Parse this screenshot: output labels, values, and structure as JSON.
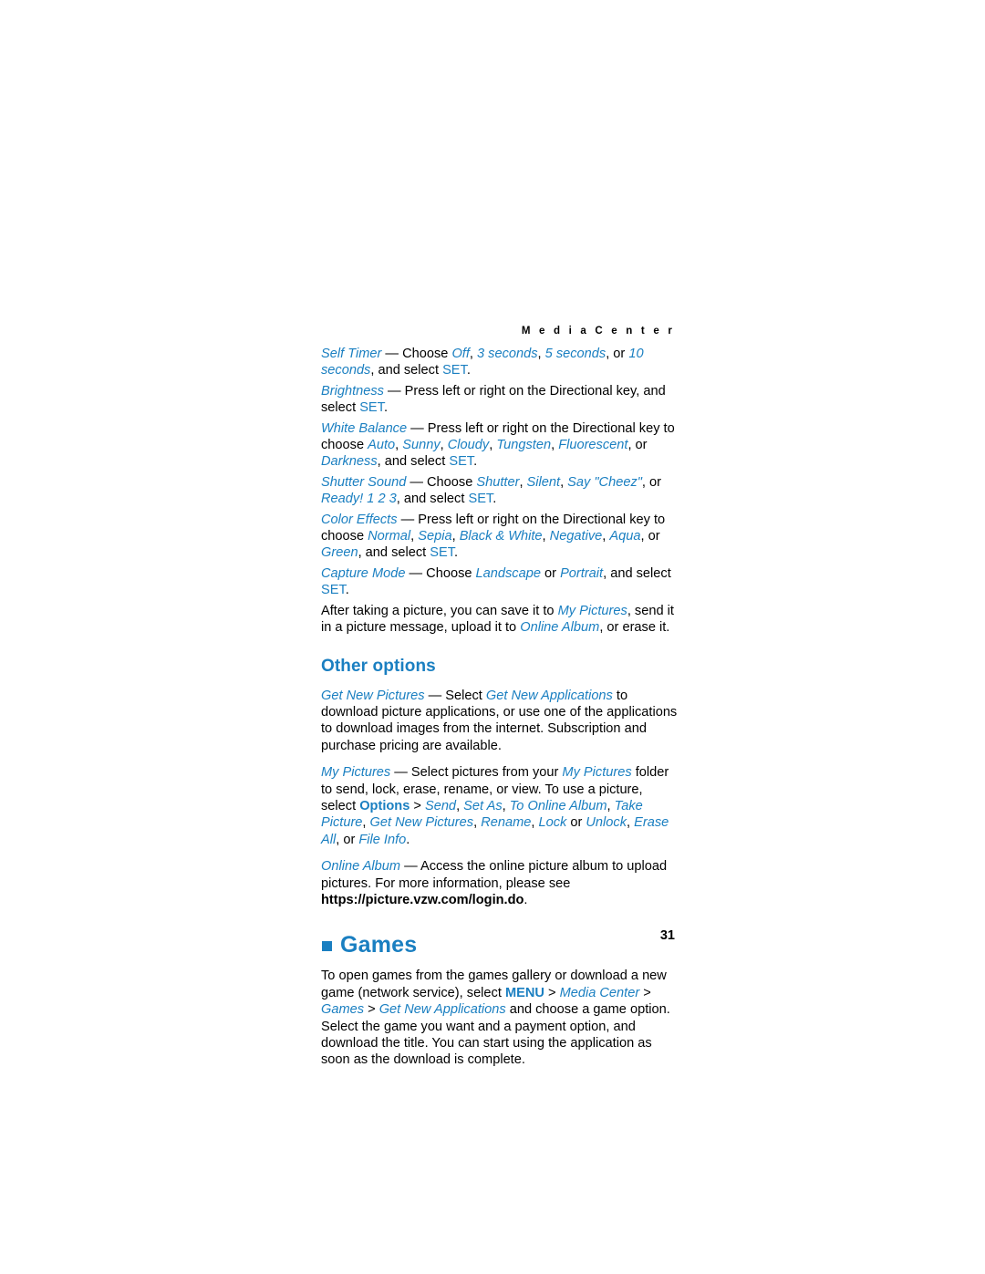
{
  "header": {
    "running_head": "M e d i a   C e n t e r"
  },
  "page_number": "31",
  "colors": {
    "accent": "#1a7fc1",
    "text": "#000000",
    "background": "#ffffff"
  },
  "paragraphs": {
    "self_timer": {
      "term": "Self Timer",
      "dash": " — Choose ",
      "opt1": "Off",
      "sep1": ", ",
      "opt2": "3 seconds",
      "sep2": ", ",
      "opt3": "5 seconds",
      "sep3": ", or ",
      "opt4": "10 seconds",
      "sep4": ", and select ",
      "set": "SET",
      "end": "."
    },
    "brightness": {
      "term": "Brightness",
      "body": " — Press left or right on the Directional key, and select ",
      "set": "SET",
      "end": "."
    },
    "white_balance": {
      "term": "White Balance",
      "body": " — Press left or right on the Directional key to choose ",
      "opt1": "Auto",
      "sep1": ", ",
      "opt2": "Sunny",
      "sep2": ", ",
      "opt3": "Cloudy",
      "sep3": ", ",
      "opt4": "Tungsten",
      "sep4": ", ",
      "opt5": "Fluorescent",
      "sep5": ", or ",
      "opt6": "Darkness",
      "sep6": ", and select ",
      "set": "SET",
      "end": "."
    },
    "shutter_sound": {
      "term": "Shutter Sound",
      "body": " — Choose ",
      "opt1": "Shutter",
      "sep1": ", ",
      "opt2": "Silent",
      "sep2": ", ",
      "opt3": "Say \"Cheez\"",
      "sep3": ", or ",
      "opt4": "Ready! 1 2 3",
      "sep4": ", and select ",
      "set": "SET",
      "end": "."
    },
    "color_effects": {
      "term": "Color Effects",
      "body": " — Press left or right on the Directional key to choose ",
      "opt1": "Normal",
      "sep1": ", ",
      "opt2": "Sepia",
      "sep2": ", ",
      "opt3": "Black & White",
      "sep3": ", ",
      "opt4": "Negative",
      "sep4": ", ",
      "opt5": "Aqua",
      "sep5": ", or ",
      "opt6": "Green",
      "sep6": ", and select ",
      "set": "SET",
      "end": "."
    },
    "capture_mode": {
      "term": "Capture Mode",
      "body": " — Choose ",
      "opt1": "Landscape",
      "sep1": " or ",
      "opt2": "Portrait",
      "sep2": ", and select ",
      "set": "SET",
      "end": "."
    },
    "after_taking": {
      "part1": "After taking a picture, you can save it to ",
      "link1": "My Pictures",
      "part2": ", send it in a picture message, upload it to ",
      "link2": "Online Album",
      "part3": ", or erase it."
    }
  },
  "other_options": {
    "heading": "Other options",
    "get_new_pictures": {
      "term": "Get New Pictures",
      "mid1": " — Select ",
      "link1": "Get New Applications",
      "body": " to download picture applications, or use one of the applications to download images from the internet. Subscription and purchase pricing are available."
    },
    "my_pictures": {
      "term": "My Pictures",
      "mid1": " — Select pictures from your ",
      "link1": "My Pictures",
      "mid2": " folder to send, lock, erase, rename, or view. To use a picture, select ",
      "options": "Options",
      "arrow1": " > ",
      "o1": "Send",
      "s1": ", ",
      "o2": "Set As",
      "s2": ", ",
      "o3": "To Online Album",
      "s3": ", ",
      "o4": "Take Picture",
      "s4": ", ",
      "o5": "Get New Pictures",
      "s5": ", ",
      "o6": "Rename",
      "s6": ", ",
      "o7": "Lock",
      "s7": " or ",
      "o8": "Unlock",
      "s8": ", ",
      "o9": "Erase All",
      "s9": ", or ",
      "o10": "File Info",
      "end": "."
    },
    "online_album": {
      "term": "Online Album",
      "mid1": " — Access the online picture album to upload pictures. For more information, please see ",
      "url": "https://picture.vzw.com/login.do",
      "end": "."
    }
  },
  "games": {
    "heading": "Games",
    "body1": "To open games from the games gallery or download a new game (network service), select ",
    "menu": "MENU",
    "arrow1": " > ",
    "media_center": "Media Center",
    "arrow2": " > ",
    "games_link": "Games",
    "arrow3": " > ",
    "get_new_applications": "Get New Applications",
    "body2": " and choose a game option. Select the game you want and a payment option, and download the title. You can start using the application as soon as the download is complete."
  }
}
